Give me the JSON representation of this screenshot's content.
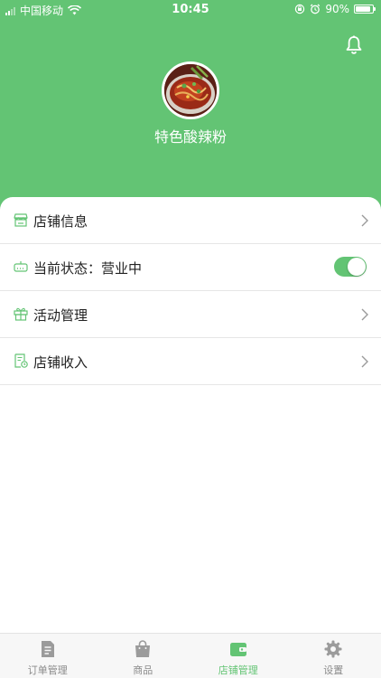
{
  "status_bar": {
    "carrier": "中国移动",
    "time": "10:45",
    "battery": "90%",
    "battery_level": 0.9
  },
  "shop": {
    "name": "特色酸辣粉"
  },
  "menu": {
    "items": [
      {
        "label": "店铺信息",
        "icon": "store-icon"
      },
      {
        "label": "当前状态：营业中",
        "icon": "status-icon",
        "toggle_on": true
      },
      {
        "label": "活动管理",
        "icon": "gift-icon"
      },
      {
        "label": "店铺收入",
        "icon": "receipt-icon"
      }
    ]
  },
  "tabbar": {
    "tabs": [
      {
        "label": "订单管理",
        "icon": "order-icon",
        "active": false
      },
      {
        "label": "商品",
        "icon": "bag-icon",
        "active": false
      },
      {
        "label": "店铺管理",
        "icon": "wallet-icon",
        "active": true
      },
      {
        "label": "设置",
        "icon": "gear-icon",
        "active": false
      }
    ]
  },
  "colors": {
    "brand_green": "#63c474",
    "inactive_gray": "#8a8a8a"
  }
}
